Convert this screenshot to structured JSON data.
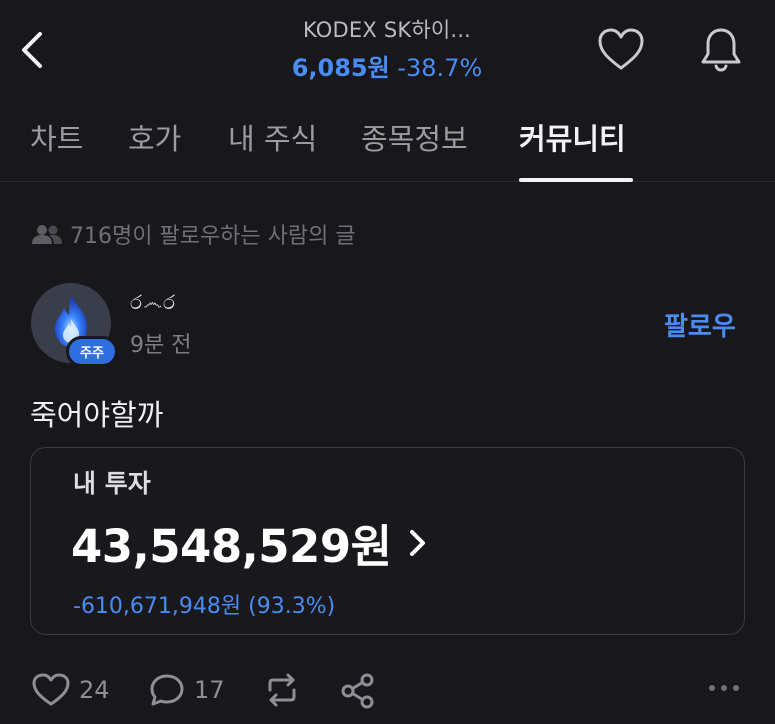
{
  "header": {
    "stock_name": "KODEX SK하이...",
    "price": "6,085원",
    "change": "-38.7%"
  },
  "tabs": [
    {
      "label": "차트"
    },
    {
      "label": "호가"
    },
    {
      "label": "내 주식"
    },
    {
      "label": "종목정보"
    },
    {
      "label": "커뮤니티",
      "active": true
    }
  ],
  "feed": {
    "follow_notice": "716명이 팔로우하는 사람의 글"
  },
  "post": {
    "username": "ර෴ර",
    "badge": "주주",
    "time": "9분 전",
    "follow_label": "팔로우",
    "text": "죽어야할까",
    "investment": {
      "label": "내 투자",
      "amount": "43,548,529원",
      "change": "-610,671,948원 (93.3%)"
    },
    "actions": {
      "likes": "24",
      "comments": "17"
    }
  },
  "colors": {
    "background": "#17171c",
    "accent_blue": "#4a8cf0",
    "text_primary": "#f0f0f3",
    "text_muted": "#7d7e86"
  },
  "icons": [
    "back-arrow-icon",
    "heart-icon",
    "bell-icon",
    "people-icon",
    "fire-icon",
    "chevron-right-icon",
    "comment-icon",
    "repost-icon",
    "share-icon",
    "more-icon"
  ]
}
